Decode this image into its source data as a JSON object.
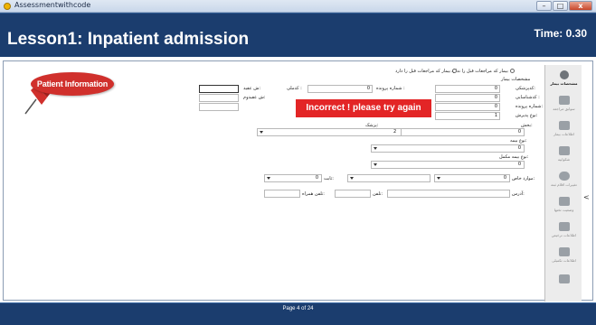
{
  "window": {
    "app_name": "Assessmentwithcode",
    "controls": {
      "minimize": "–",
      "maximize": "□",
      "close": "x"
    }
  },
  "header": {
    "lesson_title": "Lesson1: Inpatient admission",
    "timer": "Time: 0.30"
  },
  "badge": {
    "label": "Patient Information",
    "accent": "#d0302c"
  },
  "alert": {
    "message": "Incorrect !  please try again",
    "color": "#e32526"
  },
  "form": {
    "radio_prev_visit": "بیمار که مراجعات قبل را ندارد",
    "radio_no_prev": "بیمار که مراجعات قبل را دارد",
    "section_title": "مشخصات بیمار",
    "fields": {
      "national_code": {
        "label": "کدملی :",
        "value": ""
      },
      "file_no": {
        "label": "شماره پرونده :",
        "value": "0"
      },
      "patient_code_label": "کدپزشکی:",
      "patient_code": "0",
      "insurance_code_label": "کدشناسایی :",
      "insurance_code": "0",
      "insurance_no_label": "شماره پرونده:",
      "insurance_no": "0",
      "admission_type_label": "نوع پذیرش:",
      "admission_type": "1",
      "ward_label": "بخش:",
      "ward": "0",
      "doctor_label": "پزشک:",
      "doctor": "2",
      "insurance_type_label": "نوع بیمه:",
      "insurance_type": "0",
      "supp_insurance_label": "نوع بیمه مکمل:",
      "supp_insurance": "0",
      "special_cases_label": "موارد خاص:",
      "special_cases": "0",
      "address_label": "آدرس:",
      "phone_label": "تلفن:",
      "phone_alt_label": "تلفن همراه:",
      "custom_label": "ثابت:",
      "custom_value": "0",
      "desc1_label": "ش عقید:",
      "desc2_label": "ش عقیدوم:"
    }
  },
  "sidebar": {
    "items": [
      {
        "label": "مشخصات بیمار",
        "icon": "person-icon",
        "active": true
      },
      {
        "label": "سوابق مراجعه",
        "icon": "document-icon",
        "active": false
      },
      {
        "label": "اطلاعات بیمار",
        "icon": "file-icon",
        "active": false
      },
      {
        "label": "شکواییه",
        "icon": "chat-icon",
        "active": false
      },
      {
        "label": "تغییرات اقلام ثبته",
        "icon": "cloud-icon",
        "active": false
      },
      {
        "label": "وضعیت تختها",
        "icon": "bed-icon",
        "active": false
      },
      {
        "label": "اطلاعات ترخیص",
        "icon": "briefcase-icon",
        "active": false
      },
      {
        "label": "اطلاعات تکمیلی",
        "icon": "clipboard-icon",
        "active": false
      },
      {
        "label": "",
        "icon": "calendar-icon",
        "active": false
      }
    ],
    "collapse_arrow": "<"
  },
  "footer": {
    "page": "Page 4 of 24"
  }
}
